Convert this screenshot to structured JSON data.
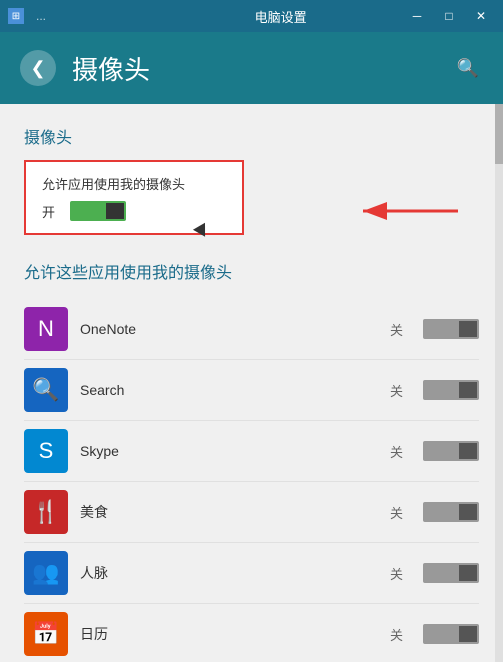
{
  "titleBar": {
    "icon": "⊞",
    "dots": "...",
    "title": "电脑设置",
    "minimize": "─",
    "restore": "□",
    "close": "✕"
  },
  "header": {
    "backLabel": "❮",
    "title": "摄像头",
    "searchIcon": "🔍"
  },
  "main": {
    "sectionTitle": "摄像头",
    "cameraToggle": {
      "label": "允许应用使用我的摄像头",
      "state": "开"
    },
    "subSectionTitle": "允许这些应用使用我的摄像头",
    "apps": [
      {
        "name": "OneNote",
        "status": "关",
        "iconBg": "#8e24aa",
        "iconText": "N"
      },
      {
        "name": "Search",
        "status": "关",
        "iconBg": "#1565c0",
        "iconText": "🔍"
      },
      {
        "name": "Skype",
        "status": "关",
        "iconBg": "#0288d1",
        "iconText": "S"
      },
      {
        "name": "美食",
        "status": "关",
        "iconBg": "#c62828",
        "iconText": "🍴"
      },
      {
        "name": "人脉",
        "status": "关",
        "iconBg": "#1565c0",
        "iconText": "👥"
      },
      {
        "name": "日历",
        "status": "关",
        "iconBg": "#e65100",
        "iconText": "📅"
      }
    ]
  }
}
